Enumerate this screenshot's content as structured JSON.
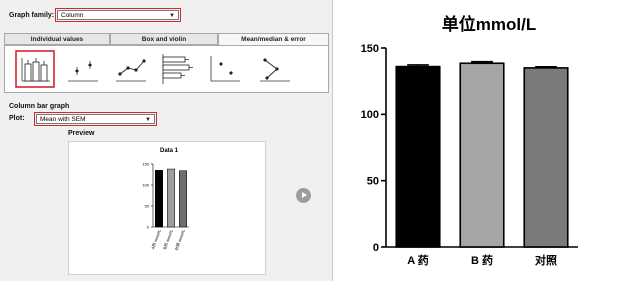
{
  "dialog": {
    "graph_family_label": "Graph family:",
    "graph_family_value": "Column",
    "tabs": [
      "Individual values",
      "Box and violin",
      "Mean/median & error"
    ],
    "section_label": "Column bar graph",
    "plot_label": "Plot:",
    "plot_value": "Mean with SEM",
    "preview_label": "Preview",
    "accent_color": "#d6262e",
    "thumbnails": [
      "bar-with-error-icon",
      "dot-mean-icon",
      "line-mean-icon",
      "horizontal-bar-icon",
      "scatter-mean-icon",
      "connected-mean-icon"
    ]
  },
  "preview_chart": {
    "title": "Data 1",
    "yticks": [
      "0",
      "50",
      "100",
      "150"
    ],
    "categories": [
      "A药 mmol/L",
      "B药 mmol/L",
      "对照 mmol/L"
    ]
  },
  "chart_data": [
    {
      "type": "bar",
      "title": "Data 1",
      "categories": [
        "A药 mmol/L",
        "B药 mmol/L",
        "对照 mmol/L"
      ],
      "series": [
        {
          "values": [
            135,
            138,
            134
          ]
        }
      ],
      "ylim": [
        0,
        150
      ],
      "yticks": [
        0,
        50,
        100,
        150
      ],
      "colors": [
        "#000000",
        "#9e9e9e",
        "#6e6e6e"
      ]
    },
    {
      "type": "bar",
      "title": "单位mmol/L",
      "categories": [
        "A 药",
        "B 药",
        "对照"
      ],
      "series": [
        {
          "values": [
            136,
            138.5,
            135
          ],
          "errors": [
            1.2,
            1.2,
            0.8
          ]
        }
      ],
      "ylim": [
        0,
        150
      ],
      "yticks": [
        0,
        50,
        100,
        150
      ],
      "colors": [
        "#000000",
        "#a5a5a5",
        "#7a7a7a"
      ]
    }
  ],
  "main_chart": {
    "title": "单位mmol/L",
    "yticks": [
      "0",
      "50",
      "100",
      "150"
    ],
    "categories": [
      "A 药",
      "B 药",
      "对照"
    ]
  }
}
